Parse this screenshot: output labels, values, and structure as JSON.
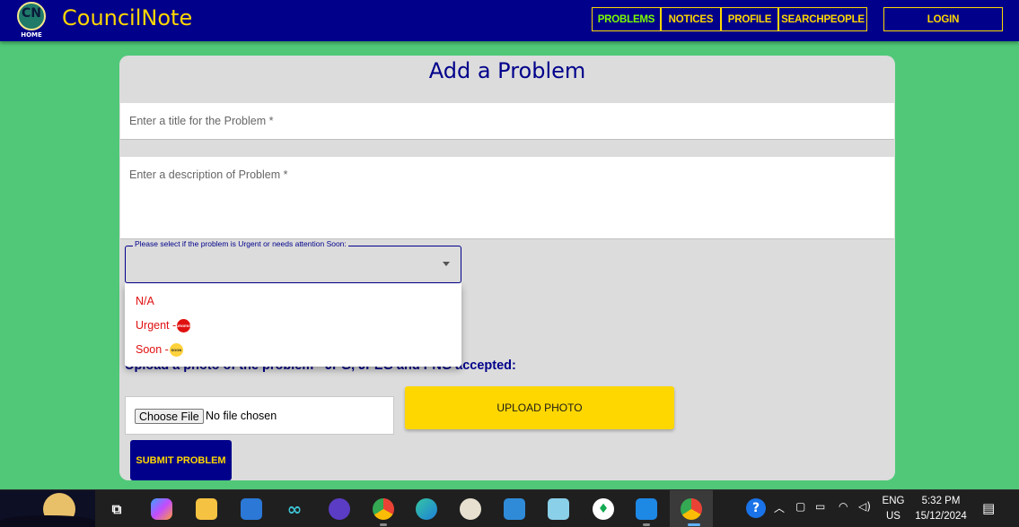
{
  "navbar": {
    "logo_text": "CN",
    "logo_sub": "HOME",
    "brand": "CouncilNote",
    "links": [
      "PROBLEMS",
      "NOTICES",
      "PROFILE",
      "SEARCHPEOPLE"
    ],
    "login": "LOGIN",
    "colors": {
      "background": "#00008b",
      "accent": "#ffd700",
      "active": "#7cfc00"
    }
  },
  "form": {
    "title": "Add a Problem",
    "title_placeholder": "Enter a title for the Problem *",
    "description_placeholder": "Enter a description of Problem *",
    "urgency_label": "Please select if the problem is Urgent or needs attention Soon:",
    "urgency_options": [
      {
        "label": "N/A",
        "badge": ""
      },
      {
        "label": "Urgent -",
        "badge": "URGENT"
      },
      {
        "label": "Soon -",
        "badge": "SOON"
      }
    ],
    "upload_label": "Upload a photo of the problem - JPG, JPEG and PNG accepted:",
    "choose_file": "Choose File",
    "file_status": "No file chosen",
    "upload_button": "UPLOAD PHOTO",
    "submit_button": "SUBMIT PROBLEM"
  },
  "taskbar": {
    "apps": [
      "task-view-icon",
      "copilot-icon",
      "file-explorer-icon",
      "microsoft-store-icon",
      "infinity-app-icon",
      "eye-app-icon",
      "chrome-icon",
      "edge-icon",
      "paint-icon",
      "photos-icon",
      "notepad-icon",
      "mongodb-icon",
      "vscode-icon",
      "chrome-profile-icon"
    ],
    "language_line1": "ENG",
    "language_line2": "US",
    "time": "5:32 PM",
    "date": "15/12/2024"
  }
}
